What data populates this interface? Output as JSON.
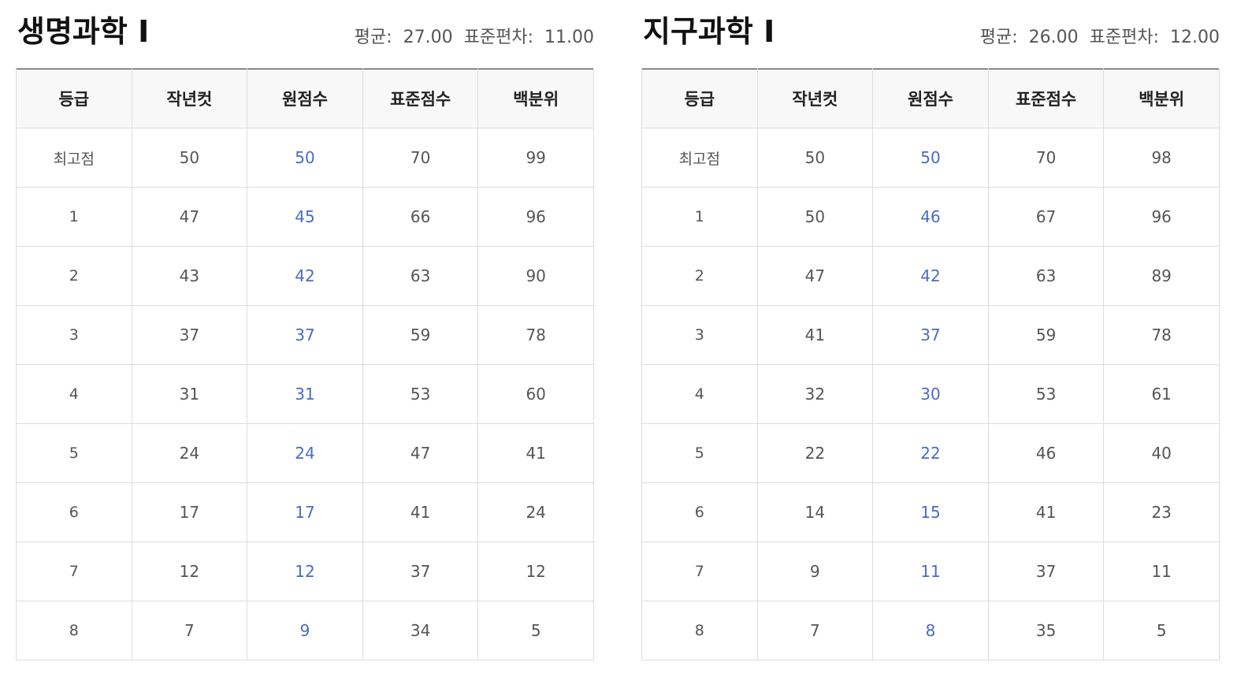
{
  "colors": {
    "raw_score": "#4a6bc5",
    "header_bg": "#f8f8f8",
    "border": "#dddddd",
    "top_rule": "#222222"
  },
  "panels": [
    {
      "title": "생명과학 I",
      "stats": {
        "avg_label": "평균:",
        "avg_value": "27.00",
        "sd_label": "표준편차:",
        "sd_value": "11.00"
      },
      "columns": [
        "등급",
        "작년컷",
        "원점수",
        "표준점수",
        "백분위"
      ],
      "rows": [
        [
          "최고점",
          "50",
          "50",
          "70",
          "99"
        ],
        [
          "1",
          "47",
          "45",
          "66",
          "96"
        ],
        [
          "2",
          "43",
          "42",
          "63",
          "90"
        ],
        [
          "3",
          "37",
          "37",
          "59",
          "78"
        ],
        [
          "4",
          "31",
          "31",
          "53",
          "60"
        ],
        [
          "5",
          "24",
          "24",
          "47",
          "41"
        ],
        [
          "6",
          "17",
          "17",
          "41",
          "24"
        ],
        [
          "7",
          "12",
          "12",
          "37",
          "12"
        ],
        [
          "8",
          "7",
          "9",
          "34",
          "5"
        ]
      ]
    },
    {
      "title": "지구과학 I",
      "stats": {
        "avg_label": "평균:",
        "avg_value": "26.00",
        "sd_label": "표준편차:",
        "sd_value": "12.00"
      },
      "columns": [
        "등급",
        "작년컷",
        "원점수",
        "표준점수",
        "백분위"
      ],
      "rows": [
        [
          "최고점",
          "50",
          "50",
          "70",
          "98"
        ],
        [
          "1",
          "50",
          "46",
          "67",
          "96"
        ],
        [
          "2",
          "47",
          "42",
          "63",
          "89"
        ],
        [
          "3",
          "41",
          "37",
          "59",
          "78"
        ],
        [
          "4",
          "32",
          "30",
          "53",
          "61"
        ],
        [
          "5",
          "22",
          "22",
          "46",
          "40"
        ],
        [
          "6",
          "14",
          "15",
          "41",
          "23"
        ],
        [
          "7",
          "9",
          "11",
          "37",
          "11"
        ],
        [
          "8",
          "7",
          "8",
          "35",
          "5"
        ]
      ]
    }
  ]
}
